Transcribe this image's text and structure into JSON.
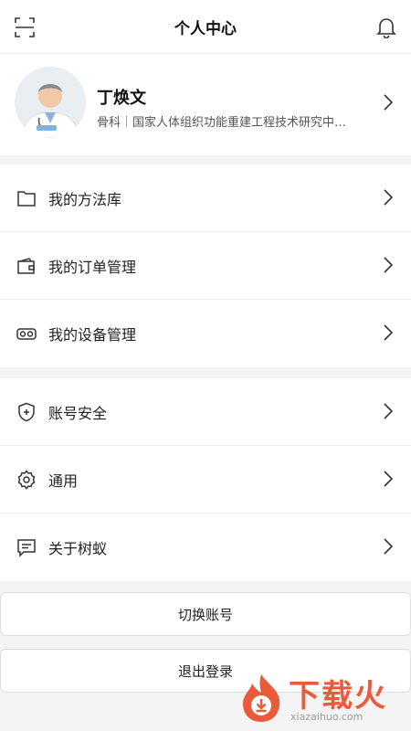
{
  "header": {
    "title": "个人中心",
    "scan_icon": "scan-icon",
    "bell_icon": "bell-icon"
  },
  "profile": {
    "name": "丁焕文",
    "desc": "骨科｜国家人体组织功能重建工程技术研究中…"
  },
  "menu_group_1": [
    {
      "label": "我的方法库",
      "icon": "folder-icon"
    },
    {
      "label": "我的订单管理",
      "icon": "wallet-icon"
    },
    {
      "label": "我的设备管理",
      "icon": "vr-headset-icon"
    }
  ],
  "menu_group_2": [
    {
      "label": "账号安全",
      "icon": "shield-plus-icon"
    },
    {
      "label": "通用",
      "icon": "gear-icon"
    },
    {
      "label": "关于树蚁",
      "icon": "message-icon"
    }
  ],
  "buttons": {
    "switch_account": "切换账号",
    "logout": "退出登录"
  },
  "watermark": {
    "text": "下载火",
    "sub": "xiazaihuo.com"
  },
  "colors": {
    "watermark": "#ea5a3b",
    "background": "#f4f4f4"
  }
}
